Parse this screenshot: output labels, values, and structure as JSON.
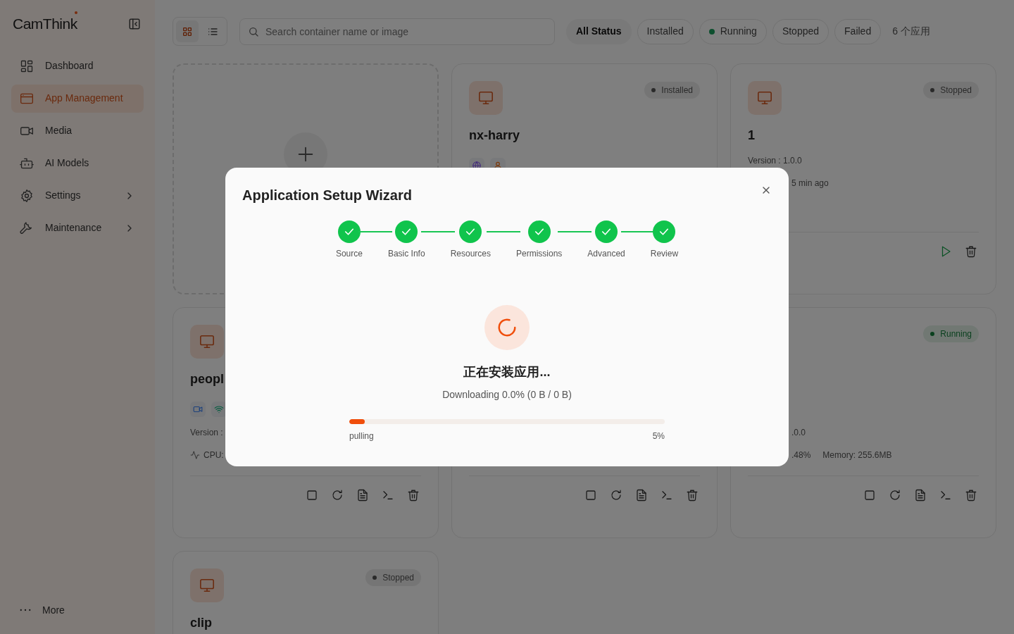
{
  "sidebar": {
    "logo": "CamThink",
    "items": [
      {
        "label": "Dashboard",
        "selected": false,
        "submenu": false
      },
      {
        "label": "App Management",
        "selected": true,
        "submenu": false
      },
      {
        "label": "Media",
        "selected": false,
        "submenu": false
      },
      {
        "label": "AI Models",
        "selected": false,
        "submenu": false
      },
      {
        "label": "Settings",
        "selected": false,
        "submenu": true
      },
      {
        "label": "Maintenance",
        "selected": false,
        "submenu": true
      }
    ],
    "more": "More"
  },
  "toolbar": {
    "views": [
      {
        "kind": "grid",
        "selected": true
      },
      {
        "kind": "list",
        "selected": false
      }
    ],
    "search": {
      "placeholder": "Search container name or image"
    },
    "filters": [
      {
        "label": "All Status",
        "selected": true
      },
      {
        "label": "Installed",
        "selected": false
      },
      {
        "label": "Running",
        "selected": false,
        "dot": true
      },
      {
        "label": "Stopped",
        "selected": false
      },
      {
        "label": "Failed",
        "selected": false
      }
    ],
    "count": "6 个应用"
  },
  "apps": [
    {
      "kind": "add"
    },
    {
      "kind": "app",
      "name": "nx-harry",
      "status": {
        "label": "Installed",
        "kind": "idle"
      },
      "tags": [
        {
          "kind": "globe"
        },
        {
          "kind": "user"
        }
      ]
    },
    {
      "kind": "app",
      "name": "1",
      "status": {
        "label": "Stopped",
        "kind": "idle"
      },
      "lines": [
        {
          "text": "Version : 1.0.0",
          "hidden_start": false
        },
        {
          "text": "5 min ago",
          "hidden_start": true
        }
      ],
      "actions": [
        {
          "kind": "start"
        },
        {
          "kind": "delete"
        }
      ]
    },
    {
      "kind": "app",
      "name": "peopl",
      "tags": [
        {
          "kind": "video"
        },
        {
          "kind": "wifi"
        }
      ],
      "lines": [
        {
          "text": "Version :",
          "hidden_start": false
        },
        {
          "text": "CPU:",
          "hidden_start": false,
          "pulse": true
        }
      ],
      "actions": [
        {
          "kind": "stop"
        },
        {
          "kind": "restart"
        },
        {
          "kind": "logs"
        },
        {
          "kind": "terminal"
        },
        {
          "kind": "delete"
        }
      ]
    },
    {
      "kind": "app",
      "actions": [
        {
          "kind": "stop"
        },
        {
          "kind": "restart"
        },
        {
          "kind": "logs"
        },
        {
          "kind": "terminal"
        },
        {
          "kind": "delete"
        }
      ]
    },
    {
      "kind": "app",
      "status": {
        "label": "Running",
        "kind": "running"
      },
      "lines": [
        {
          "text": ".0.0",
          "hidden_start": true
        },
        {
          "text": ".48%",
          "hidden_start": true,
          "extra": "Memory: 255.6MB"
        }
      ],
      "actions": [
        {
          "kind": "stop"
        },
        {
          "kind": "restart"
        },
        {
          "kind": "logs"
        },
        {
          "kind": "terminal"
        },
        {
          "kind": "delete"
        }
      ]
    },
    {
      "kind": "app",
      "name": "clip",
      "status": {
        "label": "Stopped",
        "kind": "idle"
      }
    }
  ],
  "dialog": {
    "title": "Application Setup Wizard",
    "steps": [
      {
        "label": "Source",
        "done": true
      },
      {
        "label": "Basic Info",
        "done": true
      },
      {
        "label": "Resources",
        "done": true
      },
      {
        "label": "Permissions",
        "done": true
      },
      {
        "label": "Advanced",
        "done": true
      },
      {
        "label": "Review",
        "done": true
      }
    ],
    "heading": "正在安装应用...",
    "detail": "Downloading 0.0% (0 B / 0 B)",
    "progress": {
      "level": 0.05,
      "phase": "pulling",
      "reading": "5%"
    }
  }
}
